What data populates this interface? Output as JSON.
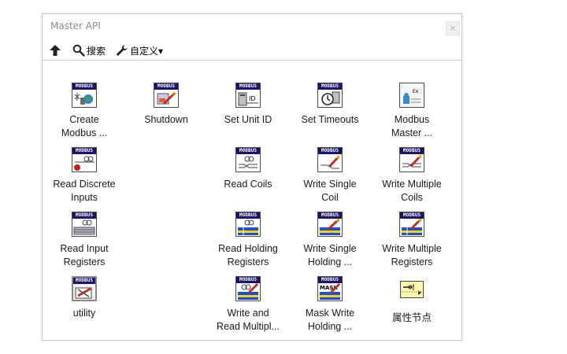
{
  "window": {
    "title": "Master API",
    "close_glyph": "×"
  },
  "toolbar": {
    "up_icon": "up-arrow-icon",
    "search_label": "搜索",
    "customize_label": "自定义▾"
  },
  "palette": {
    "icon_header_text": "MODBUS",
    "mask_text": "MASK",
    "ex_text": "Ex",
    "items": [
      {
        "label_1": "Create",
        "label_2": "Modbus ...",
        "icon": "create-modbus-icon"
      },
      {
        "label_1": "Shutdown",
        "label_2": "",
        "icon": "shutdown-icon"
      },
      {
        "label_1": "Set Unit ID",
        "label_2": "",
        "icon": "set-unit-id-icon"
      },
      {
        "label_1": "Set Timeouts",
        "label_2": "",
        "icon": "set-timeouts-icon"
      },
      {
        "label_1": "Modbus",
        "label_2": "Master ...",
        "icon": "modbus-master-example-icon"
      },
      {
        "label_1": "Read Discrete",
        "label_2": "Inputs",
        "icon": "read-discrete-inputs-icon"
      },
      {
        "label_1": "Read Coils",
        "label_2": "",
        "icon": "read-coils-icon"
      },
      {
        "label_1": "Write Single",
        "label_2": "Coil",
        "icon": "write-single-coil-icon"
      },
      {
        "label_1": "Write Multiple",
        "label_2": "Coils",
        "icon": "write-multiple-coils-icon"
      },
      {
        "label_1": "Read Input",
        "label_2": "Registers",
        "icon": "read-input-registers-icon"
      },
      {
        "label_1": "Read Holding",
        "label_2": "Registers",
        "icon": "read-holding-registers-icon"
      },
      {
        "label_1": "Write Single",
        "label_2": "Holding ...",
        "icon": "write-single-holding-icon"
      },
      {
        "label_1": "Write Multiple",
        "label_2": "Registers",
        "icon": "write-multiple-registers-icon"
      },
      {
        "label_1": "utility",
        "label_2": "",
        "icon": "utility-folder-icon"
      },
      {
        "label_1": "Write and",
        "label_2": "Read Multipl...",
        "icon": "write-and-read-multiple-icon"
      },
      {
        "label_1": "Mask Write",
        "label_2": "Holding ...",
        "icon": "mask-write-holding-icon"
      },
      {
        "label_1": "属性节点",
        "label_2": "",
        "icon": "property-node-icon"
      }
    ]
  },
  "colors": {
    "modbus_header": "#1a1466",
    "register_blue": "#2250c8",
    "register_yellow": "#f0d020",
    "property_node": "#fff7b0"
  }
}
